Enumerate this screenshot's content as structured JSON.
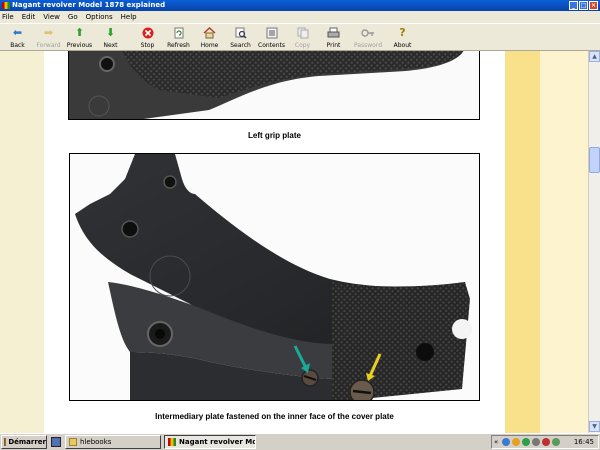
{
  "window": {
    "title": "Nagant revolver Model 1878 explained"
  },
  "menu": [
    "File",
    "Edit",
    "View",
    "Go",
    "Options",
    "Help"
  ],
  "toolbar": [
    {
      "name": "back",
      "label": "Back",
      "icon": "arrow-left-icon",
      "enabled": true
    },
    {
      "name": "forward",
      "label": "Forward",
      "icon": "arrow-right-icon",
      "enabled": false
    },
    {
      "name": "previous",
      "label": "Previous",
      "icon": "arrow-up-icon",
      "enabled": true
    },
    {
      "name": "next",
      "label": "Next",
      "icon": "arrow-down-icon",
      "enabled": true
    },
    {
      "name": "stop",
      "label": "Stop",
      "icon": "stop-icon",
      "enabled": true
    },
    {
      "name": "refresh",
      "label": "Refresh",
      "icon": "refresh-icon",
      "enabled": true
    },
    {
      "name": "home",
      "label": "Home",
      "icon": "home-icon",
      "enabled": true
    },
    {
      "name": "search",
      "label": "Search",
      "icon": "search-icon",
      "enabled": true
    },
    {
      "name": "contents",
      "label": "Contents",
      "icon": "contents-icon",
      "enabled": true
    },
    {
      "name": "copy",
      "label": "Copy",
      "icon": "copy-icon",
      "enabled": false
    },
    {
      "name": "print",
      "label": "Print",
      "icon": "print-icon",
      "enabled": true
    },
    {
      "name": "password",
      "label": "Password",
      "icon": "key-icon",
      "enabled": false
    },
    {
      "name": "about",
      "label": "About",
      "icon": "about-icon",
      "enabled": true
    }
  ],
  "content": {
    "caption1": "Left grip plate",
    "caption2": "Intermediary plate fastened on the inner face of the cover plate"
  },
  "taskbar": {
    "start": "Démarrer",
    "tasks": [
      "hlebooks",
      "Nagant revolver Model..."
    ],
    "clock": "16:45"
  },
  "colors": {
    "margin_yellow": "#f9e08a",
    "margin_cream": "#fdf4cf",
    "titlebar_blue": "#0a5fd8"
  }
}
